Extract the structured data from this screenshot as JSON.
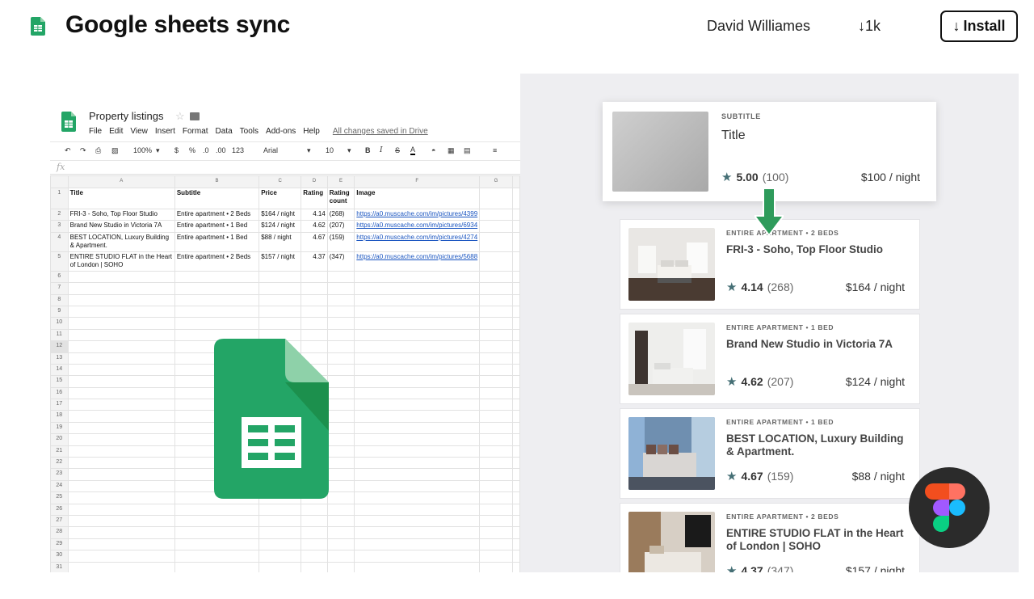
{
  "header": {
    "plugin_name": "Google sheets sync",
    "author": "David Williames",
    "downloads": "1k",
    "install_label": "Install",
    "plugin_icon": "google-sheets-icon",
    "download_icon": "arrow-down-icon"
  },
  "sheet": {
    "doc_title": "Property listings",
    "menu": [
      "File",
      "Edit",
      "View",
      "Insert",
      "Format",
      "Data",
      "Tools",
      "Add-ons",
      "Help"
    ],
    "save_status": "All changes saved in Drive",
    "toolbar": {
      "zoom": "100%",
      "currency": "$",
      "percent": "%",
      "decimal_less": ".0",
      "decimal_more": ".00",
      "number_format": "123",
      "font": "Arial",
      "font_size": "10"
    },
    "formula_label": "fx",
    "column_letters": [
      "A",
      "B",
      "C",
      "D",
      "E",
      "F",
      "G"
    ],
    "header_row": [
      "Title",
      "Subtitle",
      "Price",
      "Rating",
      "Rating count",
      "Image",
      ""
    ],
    "rows": [
      [
        "FRI-3 - Soho, Top Floor Studio",
        "Entire apartment • 2 Beds",
        "$164 / night",
        "4.14",
        "(268)",
        "https://a0.muscache.com/im/pictures/4399",
        ""
      ],
      [
        "Brand New Studio in Victoria 7A",
        "Entire apartment • 1 Bed",
        "$124 / night",
        "4.62",
        "(207)",
        "https://a0.muscache.com/im/pictures/6934",
        ""
      ],
      [
        "BEST LOCATION, Luxury Building & Apartment.",
        "Entire apartment • 1 Bed",
        "$88 / night",
        "4.67",
        "(159)",
        "https://a0.muscache.com/im/pictures/4274",
        ""
      ],
      [
        "ENTIRE STUDIO FLAT in the Heart of London | SOHO",
        "Entire apartment • 2 Beds",
        "$157 / night",
        "4.37",
        "(347)",
        "https://a0.muscache.com/im/pictures/5688",
        ""
      ]
    ],
    "row_numbers": [
      "1",
      "2",
      "3",
      "4",
      "5",
      "6",
      "7",
      "8",
      "9",
      "10",
      "11",
      "12",
      "13",
      "14",
      "15",
      "16",
      "17",
      "18",
      "19",
      "20",
      "21",
      "22",
      "23",
      "24",
      "25",
      "26",
      "27",
      "28",
      "29",
      "30",
      "31"
    ]
  },
  "template_card": {
    "subtitle": "SUBTITLE",
    "title": "Title",
    "rating": "5.00",
    "count": "(100)",
    "price": "$100 / night"
  },
  "listings": [
    {
      "subtitle": "ENTIRE APARTMENT • 2 BEDS",
      "title": "FRI-3 - Soho, Top Floor Studio",
      "rating": "4.14",
      "count": "(268)",
      "price": "$164 / night"
    },
    {
      "subtitle": "ENTIRE APARTMENT • 1 BED",
      "title": "Brand New Studio in Victoria 7A",
      "rating": "4.62",
      "count": "(207)",
      "price": "$124 / night"
    },
    {
      "subtitle": "ENTIRE APARTMENT • 1 BED",
      "title": "BEST LOCATION, Luxury Building & Apartment.",
      "rating": "4.67",
      "count": "(159)",
      "price": "$88 / night"
    },
    {
      "subtitle": "ENTIRE APARTMENT • 2 BEDS",
      "title": "ENTIRE STUDIO FLAT in the Heart of London | SOHO",
      "rating": "4.37",
      "count": "(347)",
      "price": "$157 / night"
    }
  ],
  "colors": {
    "sheets_green": "#23a566",
    "sheets_dark_green": "#188038",
    "star_teal": "#456f75",
    "arrow_green": "#2e9b5b",
    "preview_bg": "#eeeef1"
  },
  "icons": [
    "google-sheets-icon",
    "arrow-down-icon",
    "star-icon",
    "figma-logo-icon"
  ]
}
